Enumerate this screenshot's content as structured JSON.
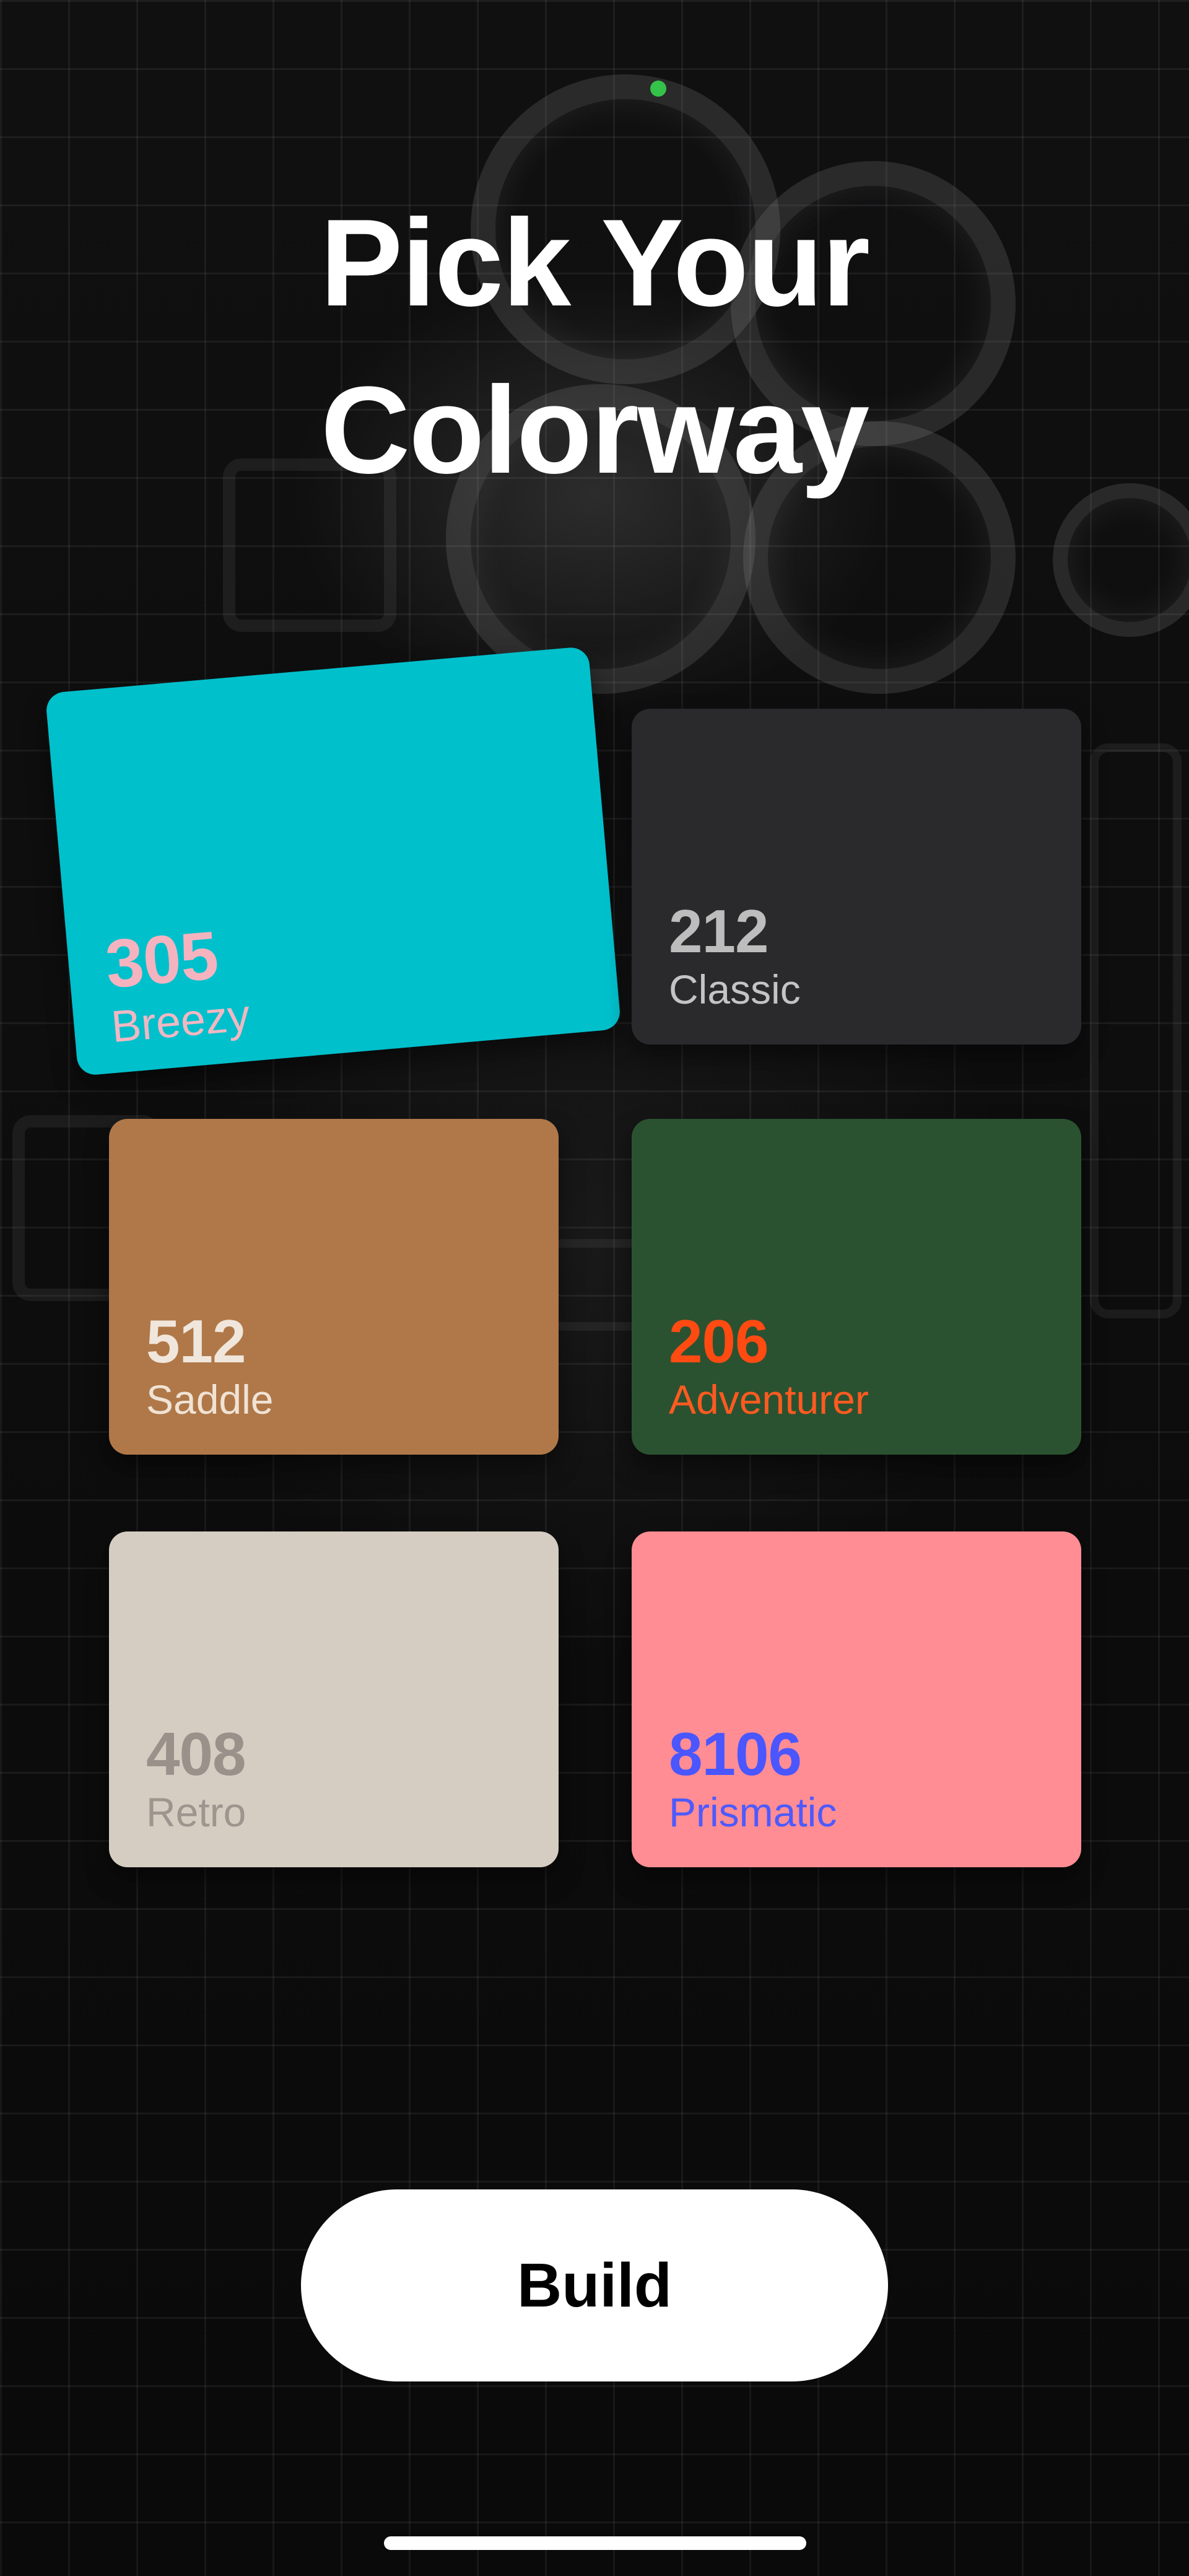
{
  "header": {
    "title_line1": "Pick Your",
    "title_line2": "Colorway"
  },
  "colorways": [
    {
      "number": "305",
      "name": "Breezy",
      "background": "#00c0cc",
      "number_color": "#f4b3bf",
      "name_color": "#f2b7c2",
      "selected": true
    },
    {
      "number": "212",
      "name": "Classic",
      "background": "#2a2a2d",
      "number_color": "#bdbdbd",
      "name_color": "#c4c4c4",
      "selected": false
    },
    {
      "number": "512",
      "name": "Saddle",
      "background": "#b07848",
      "number_color": "#f0e6dc",
      "name_color": "#f0e3d6",
      "selected": false
    },
    {
      "number": "206",
      "name": "Adventurer",
      "background": "#2b5230",
      "number_color": "#ff4a12",
      "name_color": "#ff5a20",
      "selected": false
    },
    {
      "number": "408",
      "name": "Retro",
      "background": "#d6cdc2",
      "number_color": "#9a918b",
      "name_color": "#9e958f",
      "selected": false
    },
    {
      "number": "8106",
      "name": "Prismatic",
      "background": "#ff8d93",
      "number_color": "#4a56ff",
      "name_color": "#4d5aff",
      "selected": false
    }
  ],
  "actions": {
    "build_label": "Build"
  },
  "status": {
    "indicator_color": "#35c24a"
  }
}
